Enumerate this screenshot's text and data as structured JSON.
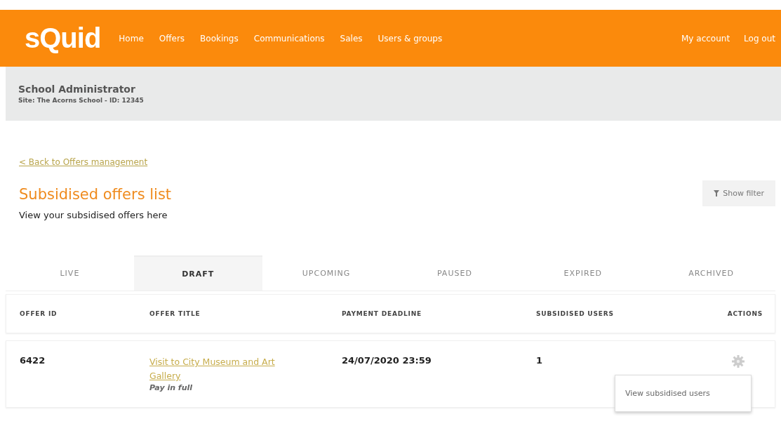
{
  "logo": "sQuid",
  "nav": {
    "items": [
      "Home",
      "Offers",
      "Bookings",
      "Communications",
      "Sales",
      "Users & groups"
    ],
    "right": [
      "My account",
      "Log out"
    ]
  },
  "user_bar": {
    "role": "School Administrator",
    "site": "Site: The Acorns School - ID: 12345"
  },
  "back_link": "< Back to Offers management",
  "heading": "Subsidised offers list",
  "subheading": "View your subsidised offers here",
  "filter_button": "Show filter",
  "tabs": [
    {
      "label": "LIVE",
      "selected": false
    },
    {
      "label": "DRAFT",
      "selected": true
    },
    {
      "label": "UPCOMING",
      "selected": false
    },
    {
      "label": "PAUSED",
      "selected": false
    },
    {
      "label": "EXPIRED",
      "selected": false
    },
    {
      "label": "ARCHIVED",
      "selected": false
    }
  ],
  "table": {
    "columns": [
      "OFFER ID",
      "OFFER TITLE",
      "PAYMENT DEADLINE",
      "SUBSIDISED USERS",
      "ACTIONS"
    ],
    "rows": [
      {
        "offer_id": "6422",
        "title": "Visit to City Museum and Art Gallery",
        "payment_type": "Pay in full",
        "deadline": "24/07/2020 23:59",
        "subsidised_users": "1"
      }
    ]
  },
  "actions_menu": {
    "items": [
      "View subsidised users"
    ]
  }
}
